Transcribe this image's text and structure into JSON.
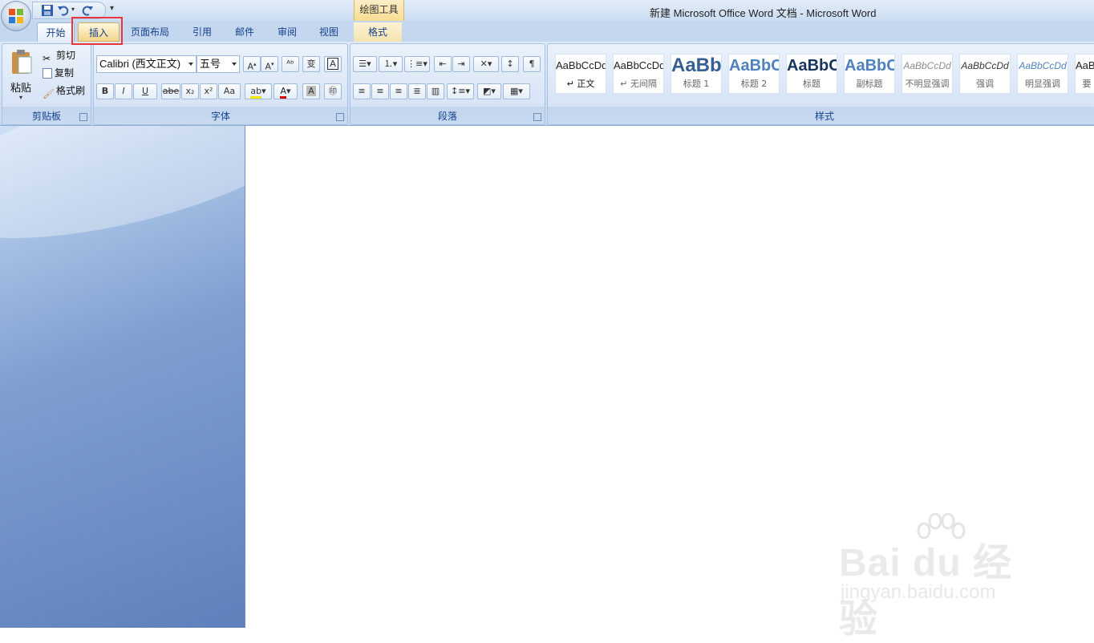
{
  "window": {
    "title": "新建 Microsoft Office Word 文档 - Microsoft Word",
    "context_tab_title": "绘图工具"
  },
  "tabs": [
    {
      "label": "开始",
      "state": "active"
    },
    {
      "label": "插入",
      "state": "highlighted"
    },
    {
      "label": "页面布局"
    },
    {
      "label": "引用"
    },
    {
      "label": "邮件"
    },
    {
      "label": "审阅"
    },
    {
      "label": "视图"
    },
    {
      "label": "格式"
    }
  ],
  "clipboard": {
    "paste": "粘贴",
    "cut": "剪切",
    "copy": "复制",
    "format_painter": "格式刷",
    "group_label": "剪贴板"
  },
  "font": {
    "font_name": "Calibri (西文正文)",
    "font_size": "五号",
    "group_label": "字体",
    "buttons": [
      "B",
      "I",
      "U",
      "abe",
      "x₂",
      "x²",
      "Aa"
    ]
  },
  "paragraph": {
    "group_label": "段落"
  },
  "styles": {
    "group_label": "样式",
    "items": [
      {
        "sample": "AaBbCcDd",
        "name": "↵ 正文"
      },
      {
        "sample": "AaBbCcDd",
        "name": "↵ 无间隔"
      },
      {
        "sample": "AaBb",
        "name": "标题 1"
      },
      {
        "sample": "AaBbC",
        "name": "标题 2"
      },
      {
        "sample": "AaBbC",
        "name": "标题"
      },
      {
        "sample": "AaBbC",
        "name": "副标题"
      },
      {
        "sample": "AaBbCcDd",
        "name": "不明显强调"
      },
      {
        "sample": "AaBbCcDd",
        "name": "强调"
      },
      {
        "sample": "AaBbCcDd",
        "name": "明显强调"
      },
      {
        "sample": "AaBb",
        "name": "要"
      }
    ]
  },
  "watermark": {
    "main": "Bai du 经验",
    "sub": "jingyan.baidu.com"
  },
  "colors": {
    "highlight_box": "#e8363b",
    "ribbon_text": "#15428b",
    "font_color_bar": "#e00000"
  }
}
